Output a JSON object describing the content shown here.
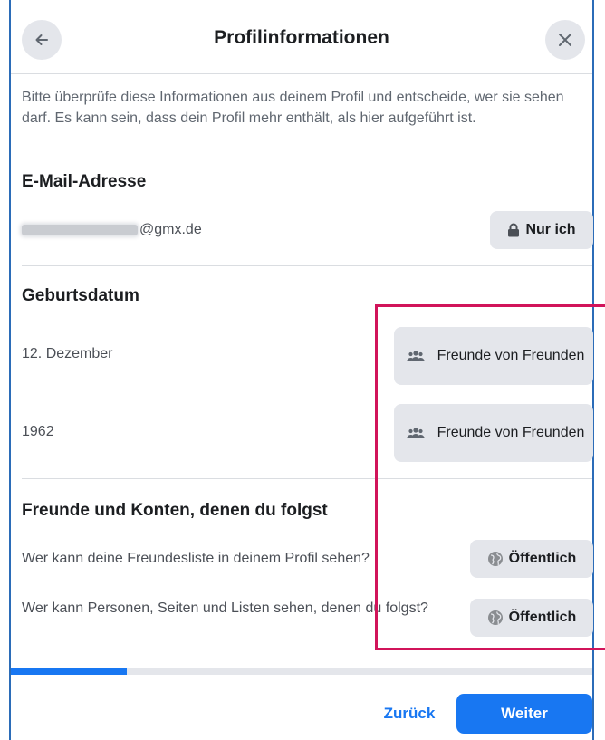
{
  "header": {
    "title": "Profilinformationen",
    "back_icon": "arrow-left-icon",
    "close_icon": "close-icon"
  },
  "intro": "Bitte überprüfe diese Informationen aus deinem Profil und entscheide, wer sie sehen darf. Es kann sein, dass dein Profil mehr enthält, als hier aufgeführt ist.",
  "email": {
    "title": "E-Mail-Adresse",
    "value_suffix": "@gmx.de",
    "audience": "Nur ich",
    "audience_icon": "lock-icon"
  },
  "birthday": {
    "title": "Geburtsdatum",
    "rows": [
      {
        "label": "12. Dezember",
        "audience": "Freunde von Freunden",
        "audience_icon": "friends-icon"
      },
      {
        "label": "1962",
        "audience": "Freunde von Freunden",
        "audience_icon": "friends-icon"
      }
    ]
  },
  "friends": {
    "title": "Freunde und Konten, denen du folgst",
    "rows": [
      {
        "label": "Wer kann deine Freundesliste in deinem Profil sehen?",
        "audience": "Öffentlich",
        "audience_icon": "globe-icon"
      },
      {
        "label": "Wer kann Personen, Seiten und Listen sehen, denen du folgst?",
        "audience": "Öffentlich",
        "audience_icon": "globe-icon"
      }
    ]
  },
  "progress": {
    "fraction": 0.2
  },
  "footer": {
    "back_label": "Zurück",
    "next_label": "Weiter"
  },
  "colors": {
    "accent": "#1877f2",
    "highlight": "#d1145a",
    "frame": "#2b6cb8",
    "pill": "#e4e6eb"
  }
}
